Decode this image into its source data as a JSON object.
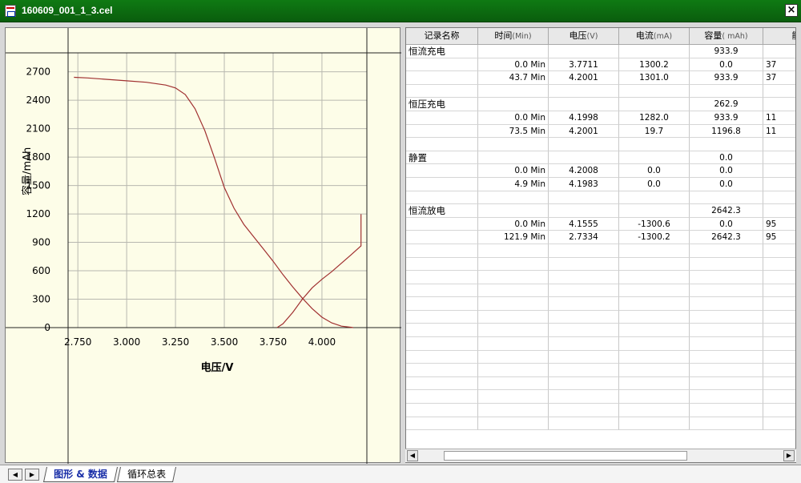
{
  "window": {
    "title": "160609_001_1_3.cel",
    "close_label": "×"
  },
  "chart_data": {
    "type": "line",
    "xlabel": "电压/V",
    "ylabel": "容量/mAh",
    "x_ticks": [
      "2.750",
      "3.000",
      "3.250",
      "3.500",
      "3.750",
      "4.000"
    ],
    "x_tick_values": [
      2.75,
      3.0,
      3.25,
      3.5,
      3.75,
      4.0
    ],
    "y_ticks": [
      "0",
      "300",
      "600",
      "900",
      "1200",
      "1500",
      "1800",
      "2100",
      "2400",
      "2700"
    ],
    "y_tick_values": [
      0,
      300,
      600,
      900,
      1200,
      1500,
      1800,
      2100,
      2400,
      2700
    ],
    "xlim": [
      2.7,
      4.23
    ],
    "ylim": [
      0,
      2900
    ],
    "grid": true,
    "line_color": "#a03030",
    "series": [
      {
        "x": [
          2.73,
          2.8,
          2.9,
          3.0,
          3.1,
          3.2,
          3.25,
          3.3,
          3.35,
          3.4,
          3.45,
          3.5,
          3.55,
          3.6,
          3.65,
          3.7,
          3.75,
          3.8,
          3.85,
          3.9,
          3.95,
          4.0,
          4.05,
          4.1,
          4.15,
          4.16
        ],
        "y": [
          2642,
          2635,
          2620,
          2605,
          2590,
          2560,
          2530,
          2460,
          2310,
          2080,
          1790,
          1480,
          1260,
          1090,
          960,
          830,
          700,
          560,
          430,
          310,
          200,
          110,
          50,
          15,
          3,
          0
        ]
      },
      {
        "x": [
          3.77,
          3.8,
          3.85,
          3.9,
          3.95,
          4.0,
          4.05,
          4.1,
          4.15,
          4.2,
          4.2,
          4.2
        ],
        "y": [
          0,
          40,
          160,
          300,
          420,
          510,
          590,
          680,
          770,
          862,
          934,
          1197
        ]
      }
    ]
  },
  "table": {
    "headers": [
      {
        "label": "记录名称",
        "unit": ""
      },
      {
        "label": "时间",
        "unit": "(Min)"
      },
      {
        "label": "电压",
        "unit": "(V)"
      },
      {
        "label": "电流",
        "unit": "(mA)"
      },
      {
        "label": "容量",
        "unit": "( mAh)"
      },
      {
        "label": "能量",
        "unit": ""
      }
    ],
    "rows": [
      [
        "恒流充电",
        "",
        "",
        "",
        "933.9",
        ""
      ],
      [
        "",
        "0.0 Min",
        "3.7711",
        "1300.2",
        "0.0",
        "37"
      ],
      [
        "",
        "43.7 Min",
        "4.2001",
        "1301.0",
        "933.9",
        "37"
      ],
      [
        "",
        "",
        "",
        "",
        "",
        ""
      ],
      [
        "恒压充电",
        "",
        "",
        "",
        "262.9",
        ""
      ],
      [
        "",
        "0.0 Min",
        "4.1998",
        "1282.0",
        "933.9",
        "11"
      ],
      [
        "",
        "73.5 Min",
        "4.2001",
        "19.7",
        "1196.8",
        "11"
      ],
      [
        "",
        "",
        "",
        "",
        "",
        ""
      ],
      [
        "静置",
        "",
        "",
        "",
        "0.0",
        ""
      ],
      [
        "",
        "0.0 Min",
        "4.2008",
        "0.0",
        "0.0",
        ""
      ],
      [
        "",
        "4.9 Min",
        "4.1983",
        "0.0",
        "0.0",
        ""
      ],
      [
        "",
        "",
        "",
        "",
        "",
        ""
      ],
      [
        "恒流放电",
        "",
        "",
        "",
        "2642.3",
        ""
      ],
      [
        "",
        "0.0 Min",
        "4.1555",
        "-1300.6",
        "0.0",
        "95"
      ],
      [
        "",
        "121.9 Min",
        "2.7334",
        "-1300.2",
        "2642.3",
        "95"
      ]
    ],
    "empty_rows": 14
  },
  "scrollbar": {
    "left_arrow": "◀",
    "right_arrow": "▶"
  },
  "tabs": {
    "nav_first": "◀",
    "nav_next": "▶",
    "items": [
      {
        "label": "图形 & 数据"
      },
      {
        "label": "循环总表"
      }
    ]
  }
}
